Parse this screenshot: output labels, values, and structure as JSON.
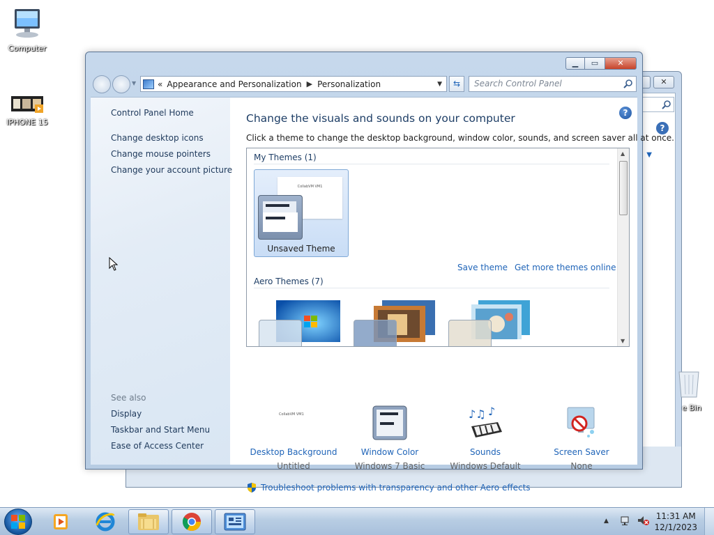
{
  "desktop": {
    "icons": [
      {
        "label": "Computer",
        "icon": "computer-icon"
      },
      {
        "label": "IPHONE 15",
        "icon": "video-file-icon"
      },
      {
        "label": "e Bin",
        "icon": "recycle-bin-icon"
      }
    ]
  },
  "window": {
    "caption": {
      "minimize": "minimize",
      "maximize": "maximize",
      "close": "close"
    },
    "breadcrumb": {
      "overflow": "«",
      "items": [
        "Appearance and Personalization",
        "Personalization"
      ]
    },
    "search_placeholder": "Search Control Panel"
  },
  "left_pane": {
    "home": "Control Panel Home",
    "links": [
      "Change desktop icons",
      "Change mouse pointers",
      "Change your account picture"
    ],
    "see_also_label": "See also",
    "see_also": [
      "Display",
      "Taskbar and Start Menu",
      "Ease of Access Center"
    ]
  },
  "main": {
    "heading": "Change the visuals and sounds on your computer",
    "subtext": "Click a theme to change the desktop background, window color, sounds, and screen saver all at once.",
    "my_themes_label": "My Themes (1)",
    "unsaved_theme": {
      "name": "Unsaved Theme",
      "thumb_text": "CollabVM VM1"
    },
    "save_theme": "Save theme",
    "get_more": "Get more themes online",
    "aero_label": "Aero Themes (7)",
    "bottom": [
      {
        "label": "Desktop Background",
        "value": "Untitled",
        "icon": "desktop-background-icon",
        "thumb_text": "CollabVM VM1"
      },
      {
        "label": "Window Color",
        "value": "Windows 7 Basic",
        "icon": "window-color-icon"
      },
      {
        "label": "Sounds",
        "value": "Windows Default",
        "icon": "sounds-icon"
      },
      {
        "label": "Screen Saver",
        "value": "None",
        "icon": "screen-saver-icon"
      }
    ],
    "troubleshoot": "Troubleshoot problems with transparency and other Aero effects"
  },
  "taskbar": {
    "apps": [
      "media-player-icon",
      "internet-explorer-icon",
      "file-explorer-icon",
      "chrome-icon",
      "control-panel-icon"
    ],
    "clock": {
      "time": "11:31 AM",
      "date": "12/1/2023"
    }
  },
  "colors": {
    "link": "#1f64b8",
    "heading": "#1e3e66",
    "close_button": "#c7432a"
  }
}
